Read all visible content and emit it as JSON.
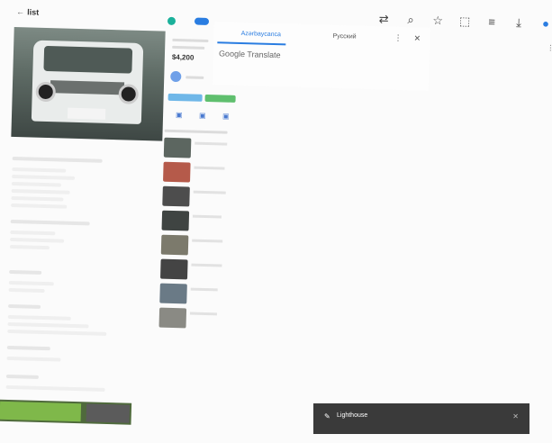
{
  "back_link": {
    "arrow": "←",
    "label": "list"
  },
  "toolbar": {
    "icons": [
      "translate-icon",
      "search-icon",
      "star-icon",
      "extensions-icon",
      "media-icon",
      "download-icon",
      "profile-icon",
      "menu-icon"
    ],
    "glyphs": [
      "⇄",
      "⌕",
      "☆",
      "⬚",
      "≡",
      "⤓",
      "●",
      "⋮"
    ]
  },
  "listing": {
    "price": "$4,200",
    "sections": [],
    "similar_prices": [
      "",
      "",
      "",
      "",
      "",
      "",
      "",
      ""
    ]
  },
  "translate": {
    "tab_active": "Azərbaycanca",
    "tab_other": "Русский",
    "more_glyph": "⋮",
    "close_glyph": "✕",
    "provider": "Google Translate"
  },
  "toast": {
    "icon": "✎",
    "text": "Lighthouse",
    "close": "✕"
  },
  "colors": {
    "accent": "#2a7de1",
    "chip_green": "#5fbf6e",
    "chip_blue": "#6fb7e8",
    "toast_bg": "#3a3a3a"
  }
}
